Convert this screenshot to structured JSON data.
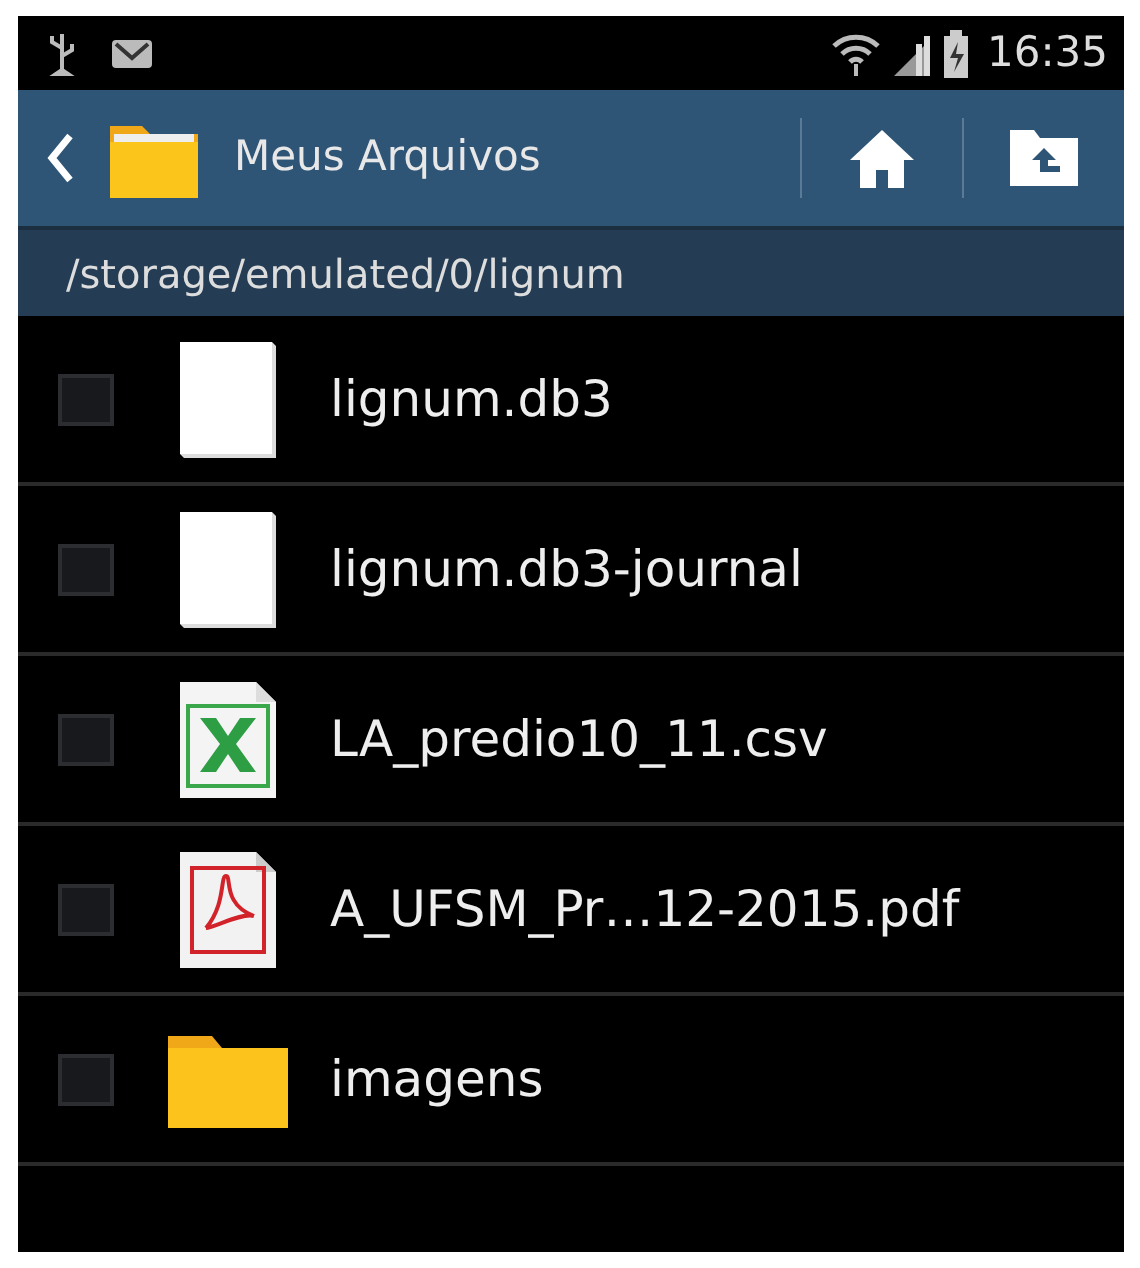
{
  "status_bar": {
    "time": "16:35"
  },
  "action_bar": {
    "title": "Meus Arquivos"
  },
  "path": "/storage/emulated/0/lignum",
  "files": [
    {
      "name": "lignum.db3",
      "kind": "blank",
      "checked": false
    },
    {
      "name": "lignum.db3-journal",
      "kind": "blank",
      "checked": false
    },
    {
      "name": "LA_predio10_11.csv",
      "kind": "excel",
      "checked": false
    },
    {
      "name": "A_UFSM_Pr…12-2015.pdf",
      "kind": "pdf",
      "checked": false
    },
    {
      "name": "imagens",
      "kind": "folder",
      "checked": false
    }
  ]
}
